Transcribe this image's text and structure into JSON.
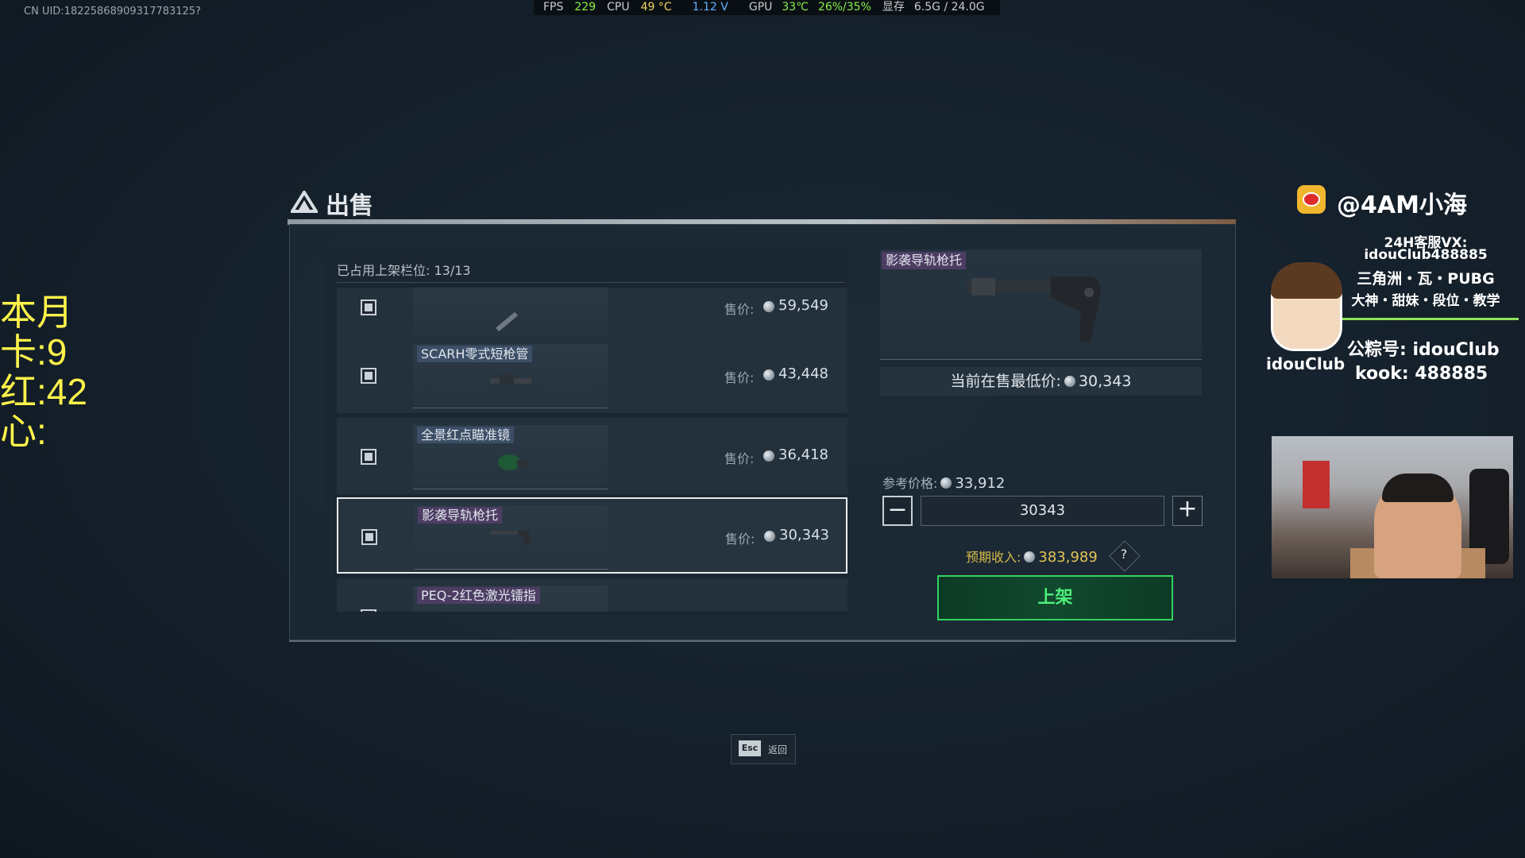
{
  "overlay": {
    "uid": "CN UID:18225868909317783125?",
    "perf": {
      "fps_label": "FPS",
      "fps": "229",
      "cpu_label": "CPU",
      "cpu_temp": "49 °C",
      "cpu_volt": "1.12 V",
      "gpu_label": "GPU",
      "gpu_temp": "33℃",
      "gpu_usage": "26%/35%",
      "vram_label": "显存",
      "vram": "6.5G / 24.0G"
    },
    "counter": [
      "本月",
      "卡:9",
      "红:42",
      "心:"
    ]
  },
  "dialog": {
    "title": "出售",
    "slot_label": "已占用上架栏位: 13/13",
    "price_label": "售价:",
    "items": [
      {
        "name": "",
        "price": "59,549",
        "selected": false
      },
      {
        "name": "SCARH零式短枪管",
        "price": "43,448",
        "selected": false,
        "tag": "blue"
      },
      {
        "name": "全景红点瞄准镜",
        "price": "36,418",
        "selected": false,
        "tag": "blue"
      },
      {
        "name": "影袭导轨枪托",
        "price": "30,343",
        "selected": true,
        "tag": "purple"
      },
      {
        "name": "PEQ-2红色激光镭指",
        "price": "",
        "selected": false,
        "tag": "purple"
      }
    ],
    "detail": {
      "item_name": "影袭导轨枪托",
      "lowest_label": "当前在售最低价:",
      "lowest_price": "30,343",
      "ref_label": "参考价格:",
      "ref_price": "33,912",
      "quantity": "30343",
      "income_label": "预期收入:",
      "income": "383,989",
      "help": "?",
      "list_button": "上架"
    },
    "esc": {
      "key": "Esc",
      "label": "返回"
    }
  },
  "stream": {
    "weibo": "@4AM小海",
    "line1": "24H客服VX:",
    "line2": "idouClub488885",
    "line3": "三角洲・瓦・PUBG",
    "line4": "大神・甜妹・段位・教学",
    "public": "公粽号: idouClub",
    "kook": "kook: 488885",
    "avatar_name": "idouClub"
  },
  "colors": {
    "accent_green": "#2fd45f",
    "purple_tag": "#4d3d63",
    "blue_tag": "#3d4f66"
  }
}
